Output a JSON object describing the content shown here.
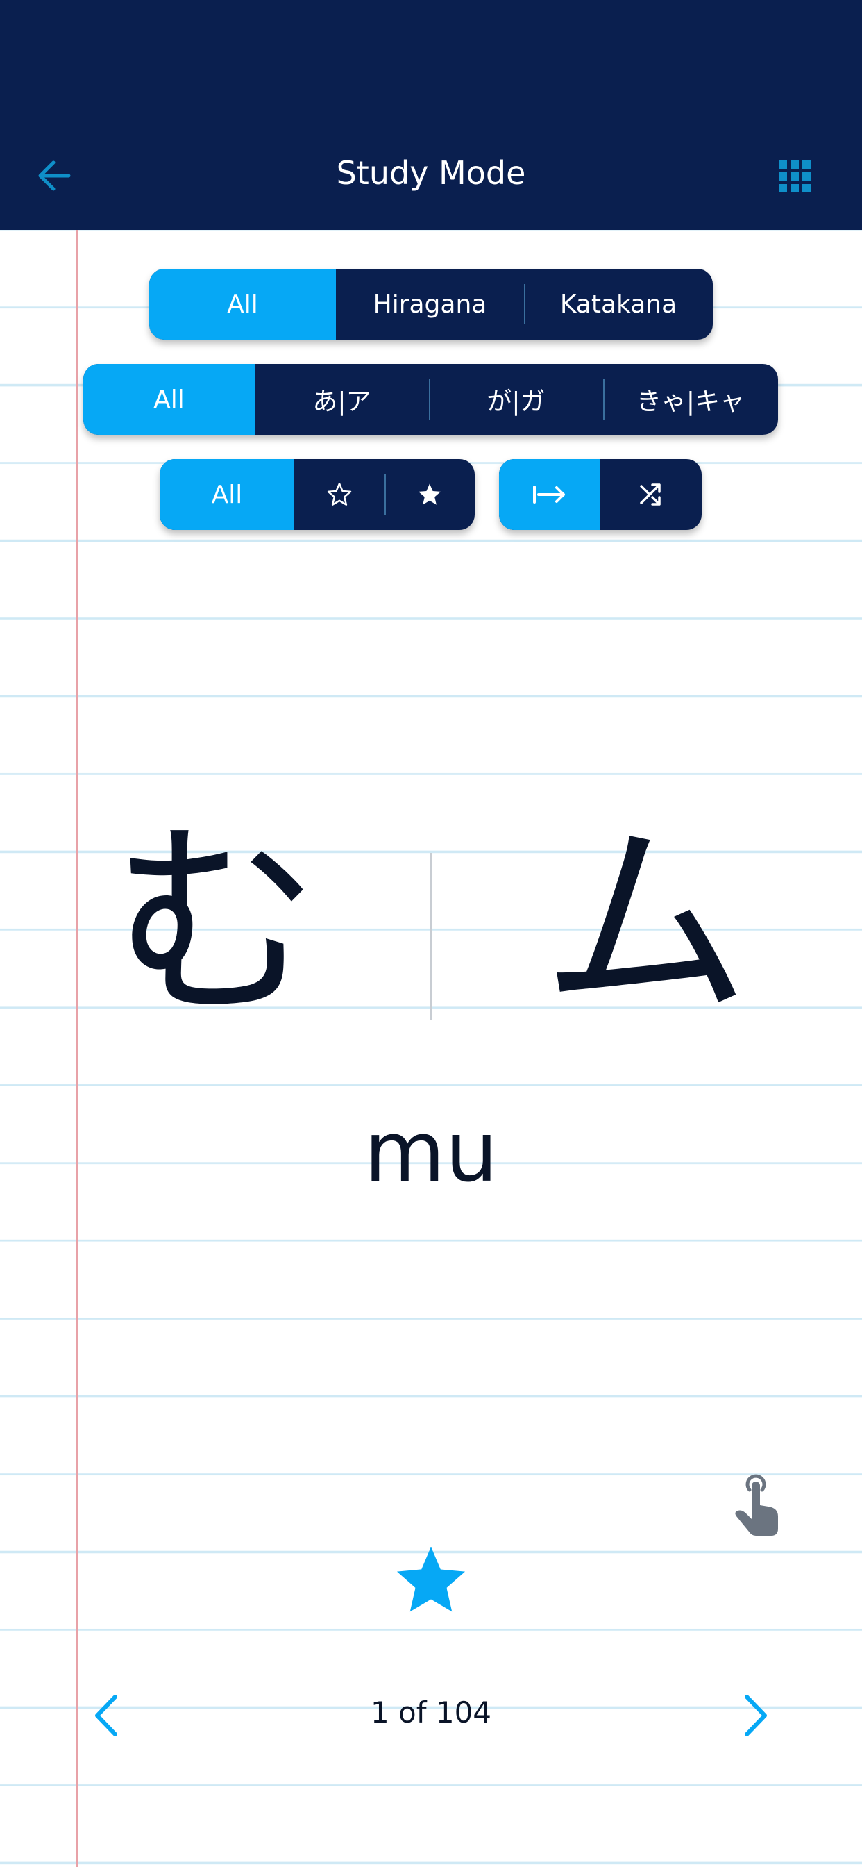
{
  "header": {
    "title": "Study Mode",
    "back_icon": "arrow-left-icon",
    "menu_icon": "grid-icon"
  },
  "filters": {
    "script": {
      "options": [
        "All",
        "Hiragana",
        "Katakana"
      ],
      "selected": "All"
    },
    "kana_type": {
      "options": [
        "All",
        "あ|ア",
        "が|ガ",
        "きゃ|キャ"
      ],
      "selected": "All"
    },
    "favorites": {
      "options": [
        "All",
        "star-outline-icon",
        "star-filled-icon"
      ],
      "selected": "All",
      "all_label": "All"
    },
    "order": {
      "options": [
        "sequential-icon",
        "shuffle-icon"
      ],
      "selected": "sequential-icon"
    }
  },
  "card": {
    "hiragana": "む",
    "katakana": "ム",
    "romaji": "mu",
    "favorited": true
  },
  "pagination": {
    "counter": "1 of 104",
    "prev_icon": "chevron-left-icon",
    "next_icon": "chevron-right-icon"
  },
  "hint_icon": "tap-gesture-icon",
  "colors": {
    "header": "#0a1f4f",
    "accent": "#06a8f5",
    "text": "#0a1428",
    "margin": "#e8a2a8",
    "rule": "#cfe9f5"
  }
}
